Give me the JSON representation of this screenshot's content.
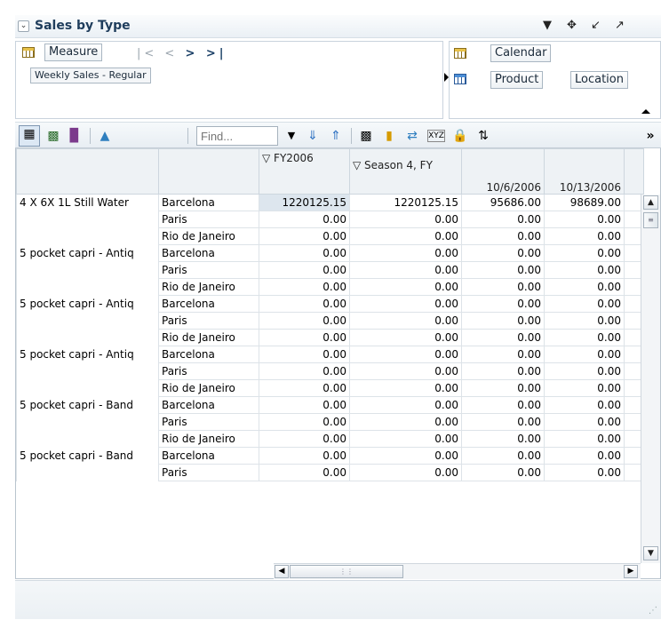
{
  "header": {
    "title": "Sales by Type",
    "collapse_icon": "chevron-down-icon",
    "actions": [
      "dropdown-icon",
      "move-icon",
      "restore-icon",
      "detach-icon"
    ]
  },
  "pivot": {
    "measure_label": "Measure",
    "measure_value": "Weekly Sales - Regular",
    "dimensions": [
      "Calendar",
      "Product",
      "Location"
    ]
  },
  "toolbar": {
    "find_placeholder": "Find...",
    "icons": [
      "table-view-icon",
      "chart-table-icon",
      "bar-chart-icon",
      "area-chart-icon",
      "dropdown-icon",
      "down-arrow-icon",
      "up-arrow-icon",
      "spreadsheet-icon",
      "highlight-icon",
      "swap-axes-icon",
      "xyz-icon",
      "lock-icon",
      "sort-icon",
      "more-icon"
    ]
  },
  "columns": [
    "FY2006",
    "Season 4, FY",
    "10/6/2006",
    "10/13/2006"
  ],
  "rows": [
    {
      "product": "4 X 6X 1L Still Water",
      "location": "Barcelona",
      "values": [
        "1220125.15",
        "1220125.15",
        "95686.00",
        "98689.00"
      ],
      "selected": true
    },
    {
      "product": "",
      "location": "Paris",
      "values": [
        "0.00",
        "0.00",
        "0.00",
        "0.00"
      ]
    },
    {
      "product": "",
      "location": "Rio de Janeiro",
      "values": [
        "0.00",
        "0.00",
        "0.00",
        "0.00"
      ]
    },
    {
      "product": "5 pocket capri - Antiq",
      "location": "Barcelona",
      "values": [
        "0.00",
        "0.00",
        "0.00",
        "0.00"
      ]
    },
    {
      "product": "",
      "location": "Paris",
      "values": [
        "0.00",
        "0.00",
        "0.00",
        "0.00"
      ]
    },
    {
      "product": "",
      "location": "Rio de Janeiro",
      "values": [
        "0.00",
        "0.00",
        "0.00",
        "0.00"
      ]
    },
    {
      "product": "5 pocket capri - Antiq",
      "location": "Barcelona",
      "values": [
        "0.00",
        "0.00",
        "0.00",
        "0.00"
      ]
    },
    {
      "product": "",
      "location": "Paris",
      "values": [
        "0.00",
        "0.00",
        "0.00",
        "0.00"
      ]
    },
    {
      "product": "",
      "location": "Rio de Janeiro",
      "values": [
        "0.00",
        "0.00",
        "0.00",
        "0.00"
      ]
    },
    {
      "product": "5 pocket capri - Antiq",
      "location": "Barcelona",
      "values": [
        "0.00",
        "0.00",
        "0.00",
        "0.00"
      ]
    },
    {
      "product": "",
      "location": "Paris",
      "values": [
        "0.00",
        "0.00",
        "0.00",
        "0.00"
      ]
    },
    {
      "product": "",
      "location": "Rio de Janeiro",
      "values": [
        "0.00",
        "0.00",
        "0.00",
        "0.00"
      ]
    },
    {
      "product": "5 pocket capri - Band",
      "location": "Barcelona",
      "values": [
        "0.00",
        "0.00",
        "0.00",
        "0.00"
      ]
    },
    {
      "product": "",
      "location": "Paris",
      "values": [
        "0.00",
        "0.00",
        "0.00",
        "0.00"
      ]
    },
    {
      "product": "",
      "location": "Rio de Janeiro",
      "values": [
        "0.00",
        "0.00",
        "0.00",
        "0.00"
      ]
    },
    {
      "product": "5 pocket capri - Band",
      "location": "Barcelona",
      "values": [
        "0.00",
        "0.00",
        "0.00",
        "0.00"
      ]
    },
    {
      "product": "",
      "location": "Paris",
      "values": [
        "0.00",
        "0.00",
        "0.00",
        "0.00"
      ]
    }
  ]
}
